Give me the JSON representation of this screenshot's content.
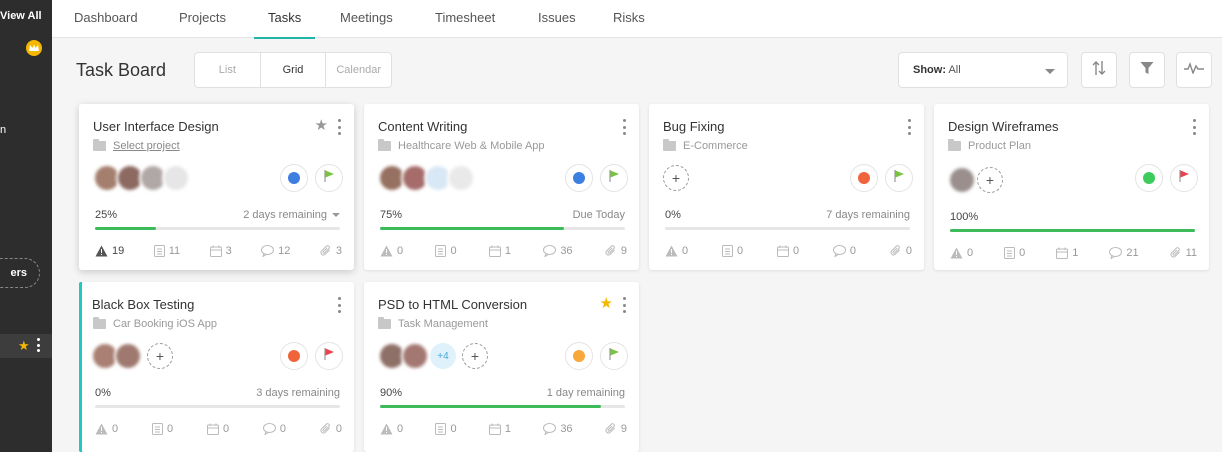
{
  "sidebar": {
    "view_all": "View All",
    "partial_label": "n",
    "pill_label": "ers"
  },
  "nav": {
    "tabs": [
      {
        "label": "Dashboard"
      },
      {
        "label": "Projects"
      },
      {
        "label": "Tasks"
      },
      {
        "label": "Meetings"
      },
      {
        "label": "Timesheet"
      },
      {
        "label": "Issues"
      },
      {
        "label": "Risks"
      }
    ],
    "active": "Tasks"
  },
  "toolbar": {
    "title": "Task Board",
    "views": [
      "List",
      "Grid",
      "Calendar"
    ],
    "active_view": "Grid",
    "show_label": "Show:",
    "show_value": "All"
  },
  "colors": {
    "accent": "#21b5a5",
    "progress": "#3dbb5a",
    "star_active": "#f5b800"
  },
  "cards": [
    {
      "title": "User Interface Design",
      "project": "Select project",
      "status_color": "#3d7fe0",
      "flag_color": "#7cc242",
      "progress_text": "25%",
      "progress": 0.25,
      "remaining": "2 days remaining",
      "stats": {
        "issues": "19",
        "docs": "11",
        "events": "3",
        "comments": "12",
        "attachments": "3"
      }
    },
    {
      "title": "Content Writing",
      "project": "Healthcare Web & Mobile App",
      "status_color": "#3d7fe0",
      "flag_color": "#7cc242",
      "progress_text": "75%",
      "progress": 0.75,
      "remaining": "Due Today",
      "stats": {
        "issues": "0",
        "docs": "0",
        "events": "1",
        "comments": "36",
        "attachments": "9"
      }
    },
    {
      "title": "Bug Fixing",
      "project": "E-Commerce",
      "status_color": "#f0643c",
      "flag_color": "#7cc242",
      "progress_text": "0%",
      "progress": 0,
      "remaining": "7 days remaining",
      "stats": {
        "issues": "0",
        "docs": "0",
        "events": "0",
        "comments": "0",
        "attachments": "0"
      }
    },
    {
      "title": "Design Wireframes",
      "project": "Product Plan",
      "status_color": "#3dcc5c",
      "flag_color": "#e8434e",
      "progress_text": "100%",
      "progress": 1,
      "remaining": "",
      "stats": {
        "issues": "0",
        "docs": "0",
        "events": "1",
        "comments": "21",
        "attachments": "11"
      }
    },
    {
      "title": "Black Box Testing",
      "project": "Car Booking iOS App",
      "status_color": "#f0643c",
      "flag_color": "#e8434e",
      "progress_text": "0%",
      "progress": 0,
      "remaining": "3 days remaining",
      "stats": {
        "issues": "0",
        "docs": "0",
        "events": "0",
        "comments": "0",
        "attachments": "0"
      }
    },
    {
      "title": "PSD to HTML Conversion",
      "project": "Task Management",
      "status_color": "#f8a73a",
      "flag_color": "#7cc242",
      "more_assignees": "+4",
      "progress_text": "90%",
      "progress": 0.9,
      "remaining": "1 day remaining",
      "stats": {
        "issues": "0",
        "docs": "0",
        "events": "1",
        "comments": "36",
        "attachments": "9"
      }
    }
  ]
}
